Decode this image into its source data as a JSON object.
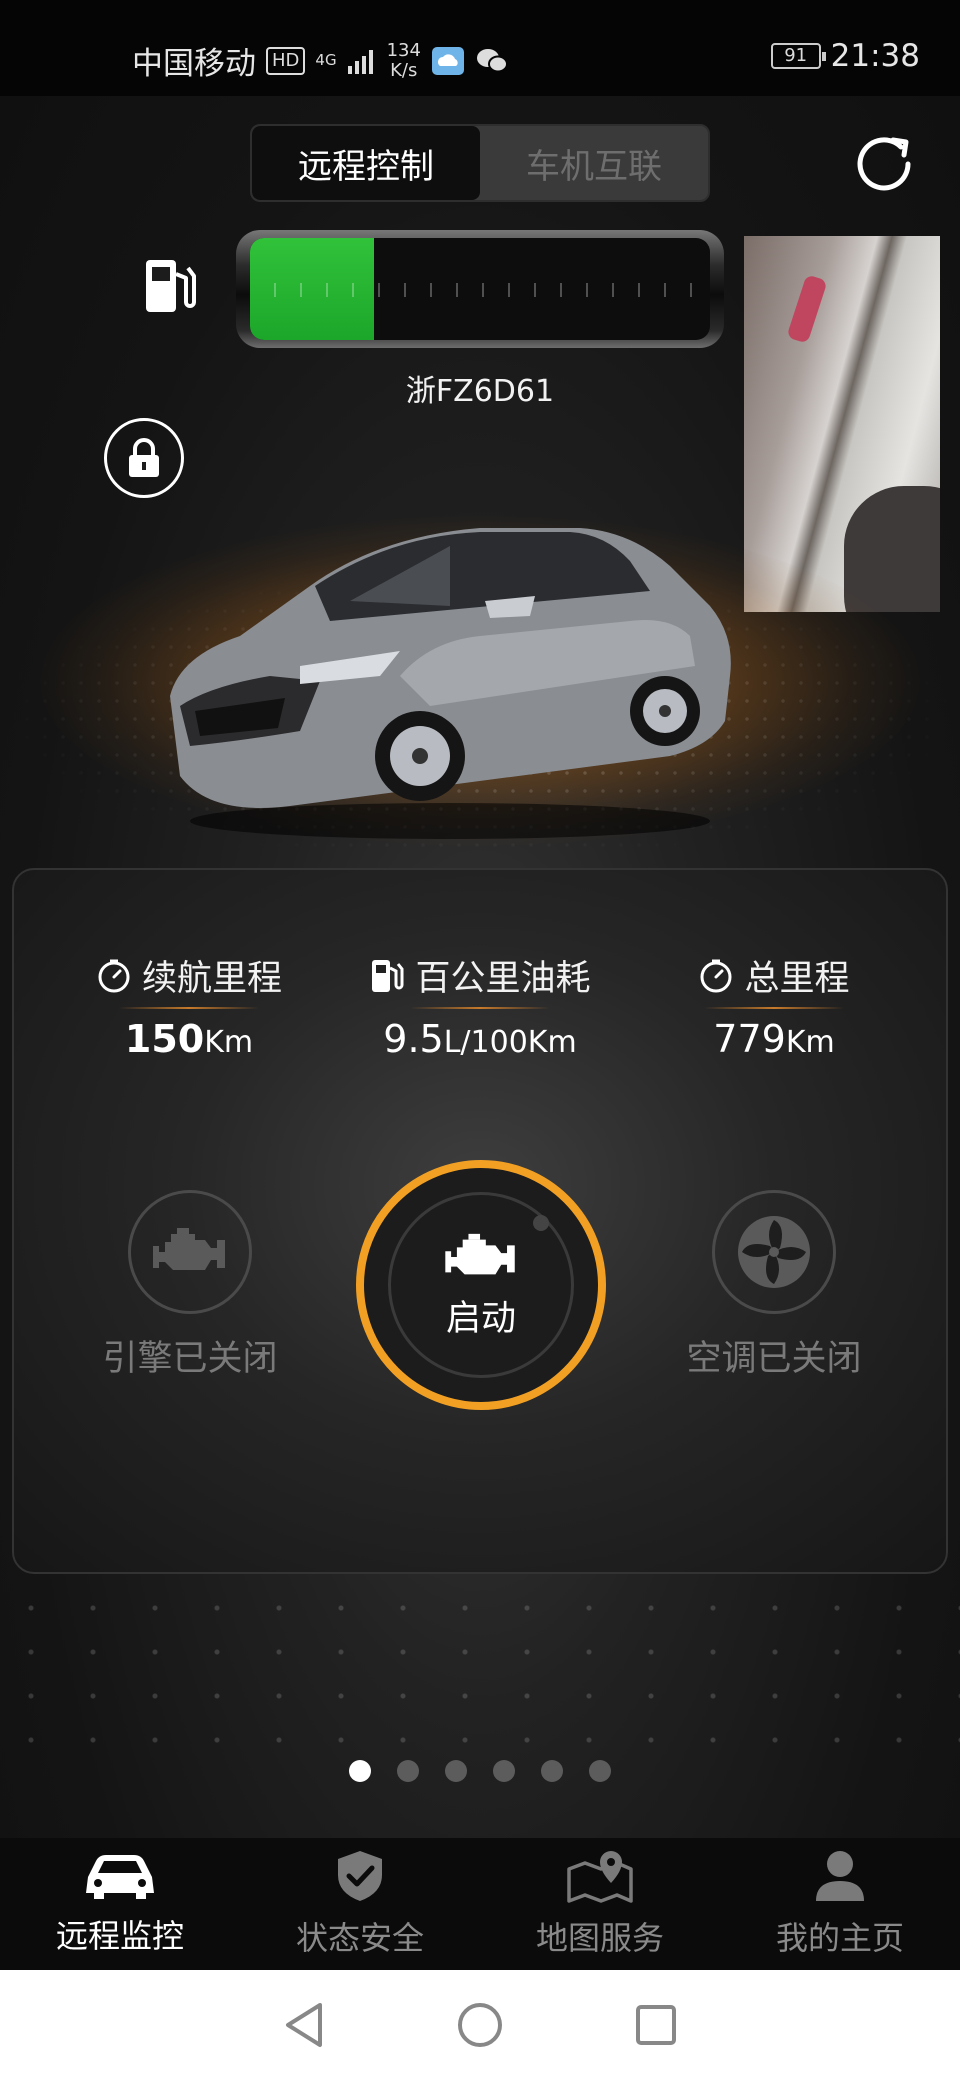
{
  "status_bar": {
    "carrier": "中国移动",
    "hd": "HD",
    "net_type": "4G",
    "speed_value": "134",
    "speed_unit": "K/s",
    "battery": "91",
    "time": "21:38"
  },
  "header": {
    "tabs": [
      {
        "label": "远程控制",
        "active": true
      },
      {
        "label": "车机互联",
        "active": false
      }
    ],
    "refresh_icon": "refresh-icon"
  },
  "vehicle": {
    "plate": "浙FZ6D61",
    "fuel_level_fraction": 0.27,
    "fuel_icon": "fuel-pump-icon",
    "lock_icon": "lock-icon"
  },
  "stats": [
    {
      "label": "续航里程",
      "value": "150",
      "unit": "Km",
      "icon": "gauge-icon"
    },
    {
      "label": "百公里油耗",
      "value": "9.5",
      "unit": "L/100Km",
      "icon": "fuel-pump-icon"
    },
    {
      "label": "总里程",
      "value": "779",
      "unit": "Km",
      "icon": "gauge-icon"
    }
  ],
  "controls": {
    "engine_label": "引擎已关闭",
    "start_label": "启动",
    "ac_label": "空调已关闭"
  },
  "pager": {
    "count": 6,
    "active": 0
  },
  "bottom_nav": [
    {
      "label": "远程监控",
      "icon": "car-icon",
      "active": true
    },
    {
      "label": "状态安全",
      "icon": "shield-check-icon",
      "active": false
    },
    {
      "label": "地图服务",
      "icon": "map-pin-icon",
      "active": false
    },
    {
      "label": "我的主页",
      "icon": "user-icon",
      "active": false
    }
  ],
  "colors": {
    "accent": "#f2a024",
    "fuel_green": "#2bb837",
    "background": "#1a1a1a"
  }
}
